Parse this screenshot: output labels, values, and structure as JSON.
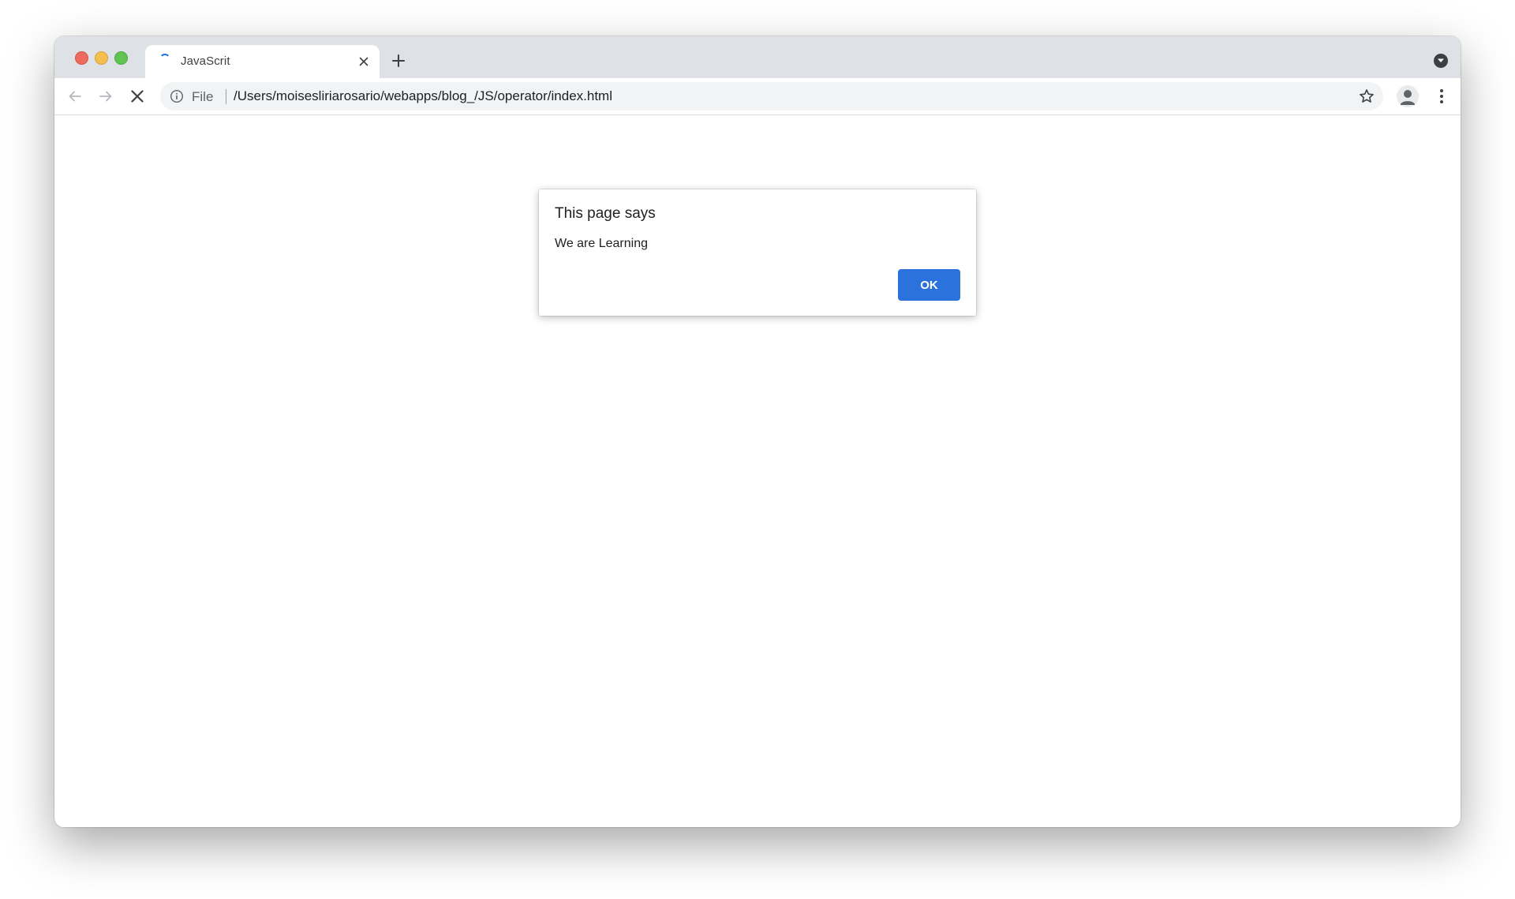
{
  "browser": {
    "tab": {
      "title": "JavaScrit"
    },
    "address_bar": {
      "scheme_label": "File",
      "url": "/Users/moisesliriarosario/webapps/blog_/JS/operator/index.html"
    }
  },
  "dialog": {
    "title": "This page says",
    "message": "We are Learning",
    "ok_label": "OK"
  },
  "colors": {
    "accent": "#2b72dd",
    "tabstrip": "#dee1e6",
    "omnibox": "#f1f3f4"
  }
}
